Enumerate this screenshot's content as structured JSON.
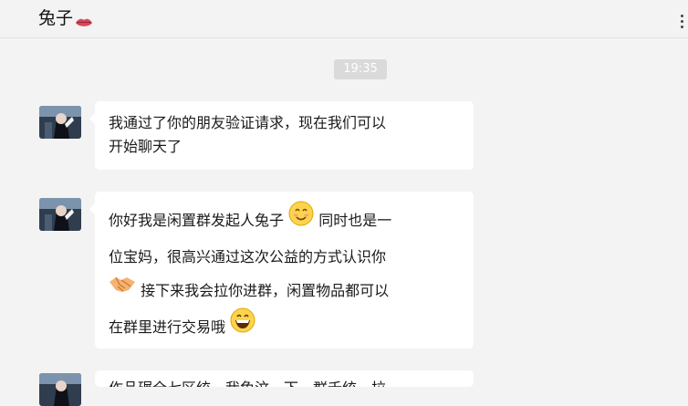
{
  "header": {
    "title": "兔子",
    "title_emoji": "lips-icon",
    "more_icon": "more-vertical-icon"
  },
  "conversation": {
    "timestamp": "19:35",
    "messages": [
      {
        "sender": "avatar",
        "lines": [
          "我通过了你的朋友验证请求，现在我们可以",
          "开始聊天了"
        ]
      },
      {
        "sender": "avatar",
        "segments": {
          "l1a": "你好我是闲置群发起人兔子",
          "l1b": " 同时也是一",
          "l2": "位宝妈，很高兴通过这次公益的方式认识你",
          "l3b": " 接下来我会拉你进群，闲置物品都可以",
          "l4a": "在群里进行交易哦"
        },
        "emojis": [
          "smiling-face-icon",
          "handshake-icon",
          "grinning-face-icon"
        ]
      },
      {
        "sender": "avatar",
        "partial_line": "作品碾全七区统一我免汶一下，群禾统一拉"
      }
    ]
  }
}
